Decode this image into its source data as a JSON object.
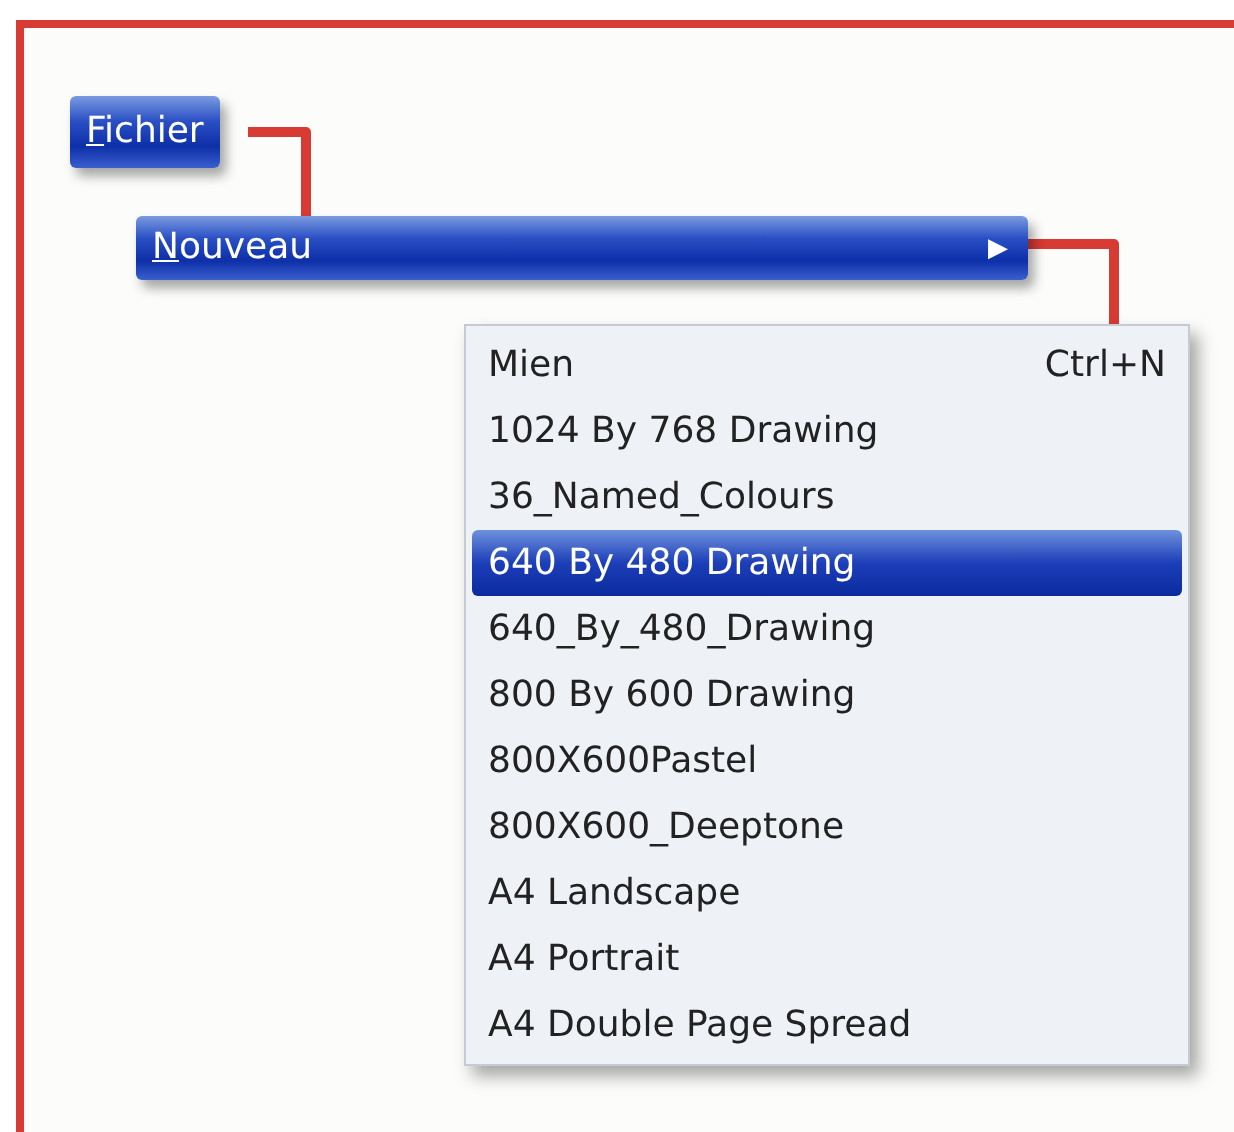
{
  "menu_bar": {
    "label": "Fichier"
  },
  "submenu": {
    "label": "Nouveau",
    "arrow": "▶"
  },
  "menu_items": [
    {
      "label": "Mien",
      "shortcut": "Ctrl+N",
      "selected": false
    },
    {
      "label": "1024 By 768 Drawing",
      "selected": false
    },
    {
      "label": "36_Named_Colours",
      "selected": false
    },
    {
      "label": "640 By 480 Drawing",
      "selected": true
    },
    {
      "label": "640_By_480_Drawing",
      "selected": false
    },
    {
      "label": "800 By 600 Drawing",
      "selected": false
    },
    {
      "label": "800X600Pastel",
      "selected": false
    },
    {
      "label": "800X600_Deeptone",
      "selected": false
    },
    {
      "label": "A4 Landscape",
      "selected": false
    },
    {
      "label": "A4 Portrait",
      "selected": false
    },
    {
      "label": "A4 Double Page Spread",
      "selected": false
    }
  ]
}
